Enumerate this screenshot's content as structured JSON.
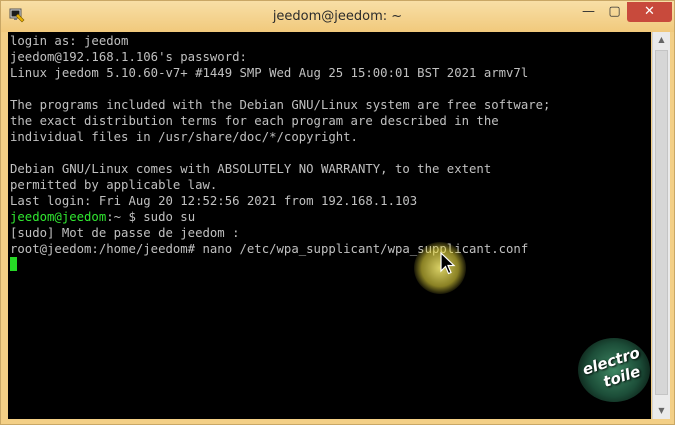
{
  "window": {
    "title": "jeedom@jeedom: ~",
    "app_icon": "putty-terminal-icon",
    "min_label": "—",
    "max_label": "▢",
    "close_label": "✕"
  },
  "terminal": {
    "lines": [
      "login as: jeedom",
      "jeedom@192.168.1.106's password:",
      "Linux jeedom 5.10.60-v7+ #1449 SMP Wed Aug 25 15:00:01 BST 2021 armv7l",
      "",
      "The programs included with the Debian GNU/Linux system are free software;",
      "the exact distribution terms for each program are described in the",
      "individual files in /usr/share/doc/*/copyright.",
      "",
      "Debian GNU/Linux comes with ABSOLUTELY NO WARRANTY, to the extent",
      "permitted by applicable law.",
      "Last login: Fri Aug 20 12:52:56 2021 from 192.168.1.103"
    ],
    "prompt_user_host": "jeedom@jeedom",
    "prompt_path": ":~ $ ",
    "prompt_command": "sudo su",
    "sudo_line": "[sudo] Mot de passe de jeedom :",
    "root_line": "root@jeedom:/home/jeedom# nano /etc/wpa_supplicant/wpa_supplicant.conf",
    "cursor_color": "#26d826",
    "text_color": "#c0c0c0",
    "prompt_color": "#30e830"
  },
  "watermark": {
    "line1": "electro",
    "line2": "toile"
  }
}
